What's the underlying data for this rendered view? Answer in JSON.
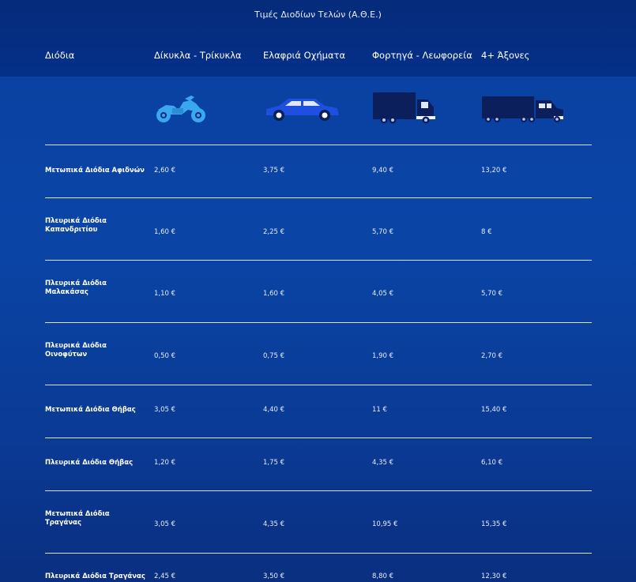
{
  "title": "Τιμές Διοδίων Τελών (Α.Θ.Ε.)",
  "columns": {
    "name": "Διόδια",
    "c1": "Δίκυκλα - Τρίκυκλα",
    "c2": "Ελαφριά Οχήματα",
    "c3": "Φορτηγά - Λεωφορεία",
    "c4": "4+ Άξονες"
  },
  "icons": {
    "c1": "motorcycle-icon",
    "c2": "car-icon",
    "c3": "truck-icon",
    "c4": "heavy-truck-icon"
  },
  "colors": {
    "motorcycle": "#3aa8f0",
    "car": "#1f4fe0",
    "truck": "#0b1f5c"
  },
  "rows": [
    {
      "name": "Μετωπικά Διόδια Αφιδνών",
      "c1": "2,60 €",
      "c2": "3,75 €",
      "c3": "9,40 €",
      "c4": "13,20 €"
    },
    {
      "name": "Πλευρικά Διόδια Καπανδριτίου",
      "c1": "1,60 €",
      "c2": "2,25 €",
      "c3": "5,70 €",
      "c4": "8 €"
    },
    {
      "name": "Πλευρικά Διόδια Μαλακάσας",
      "c1": "1,10 €",
      "c2": "1,60 €",
      "c3": "4,05 €",
      "c4": "5,70 €"
    },
    {
      "name": "Πλευρικά Διόδια Οινοφύτων",
      "c1": "0,50 €",
      "c2": "0,75 €",
      "c3": "1,90 €",
      "c4": "2,70 €"
    },
    {
      "name": "Μετωπικά Διόδια Θήβας",
      "c1": "3,05 €",
      "c2": "4,40 €",
      "c3": "11 €",
      "c4": "15,40 €"
    },
    {
      "name": "Πλευρικά Διόδια Θήβας",
      "c1": "1,20 €",
      "c2": "1,75 €",
      "c3": "4,35 €",
      "c4": "6,10 €"
    },
    {
      "name": "Μετωπικά Διόδια Τραγάνας",
      "c1": "3,05 €",
      "c2": "4,35 €",
      "c3": "10,95 €",
      "c4": "15,35 €"
    },
    {
      "name": "Πλευρικά Διόδια Τραγάνας",
      "c1": "2,45 €",
      "c2": "3,50 €",
      "c3": "8,80 €",
      "c4": "12,30 €"
    }
  ]
}
